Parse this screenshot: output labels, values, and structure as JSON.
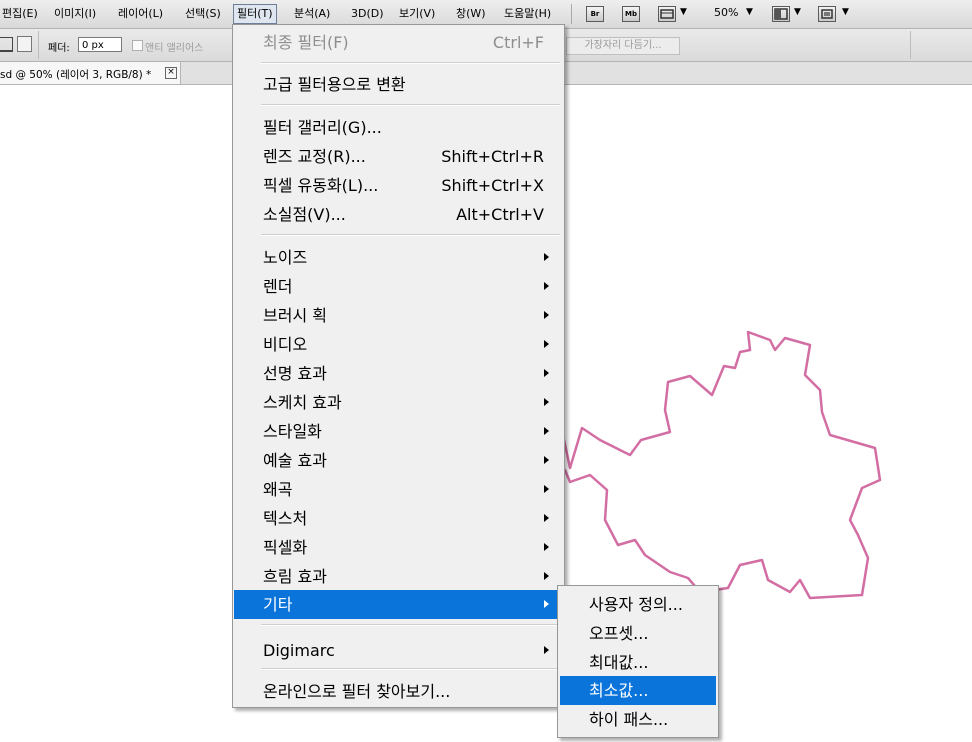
{
  "menubar": {
    "items": [
      {
        "label": "편집(E)"
      },
      {
        "label": "이미지(I)"
      },
      {
        "label": "레이어(L)"
      },
      {
        "label": "선택(S)"
      },
      {
        "label": "필터(T)"
      },
      {
        "label": "분석(A)"
      },
      {
        "label": "3D(D)"
      },
      {
        "label": "보기(V)"
      },
      {
        "label": "창(W)"
      },
      {
        "label": "도움말(H)"
      }
    ],
    "bridge_label": "Br",
    "minibridge_label": "Mb",
    "zoom_value": "50%"
  },
  "options": {
    "feather_label": "페더:",
    "feather_value": "0 px",
    "antialias_label": "앤티 앨리어스",
    "refine_edge_label": "가장자리 다듬기..."
  },
  "document": {
    "tab_title": "sd @ 50% (레이어 3, RGB/8) *",
    "close_glyph": "×"
  },
  "colors": {
    "outline": "#d36ea4",
    "highlight": "#0a74da"
  },
  "filter_menu": {
    "last_filter": {
      "label": "최종 필터(F)",
      "shortcut": "Ctrl+F"
    },
    "smart_convert": {
      "label": "고급 필터용으로 변환"
    },
    "filter_gallery": {
      "label": "필터 갤러리(G)..."
    },
    "lens_correction": {
      "label": "렌즈 교정(R)...",
      "shortcut": "Shift+Ctrl+R"
    },
    "liquify": {
      "label": "픽셀 유동화(L)...",
      "shortcut": "Shift+Ctrl+X"
    },
    "vanishing_point": {
      "label": "소실점(V)...",
      "shortcut": "Alt+Ctrl+V"
    },
    "groups": [
      {
        "label": "노이즈"
      },
      {
        "label": "렌더"
      },
      {
        "label": "브러시 획"
      },
      {
        "label": "비디오"
      },
      {
        "label": "선명 효과"
      },
      {
        "label": "스케치 효과"
      },
      {
        "label": "스타일화"
      },
      {
        "label": "예술 효과"
      },
      {
        "label": "왜곡"
      },
      {
        "label": "텍스처"
      },
      {
        "label": "픽셀화"
      },
      {
        "label": "흐림 효과"
      },
      {
        "label": "기타"
      }
    ],
    "digimarc": {
      "label": "Digimarc"
    },
    "browse_online": {
      "label": "온라인으로 필터 찾아보기..."
    }
  },
  "other_submenu": {
    "items": [
      {
        "label": "사용자 정의..."
      },
      {
        "label": "오프셋..."
      },
      {
        "label": "최대값..."
      },
      {
        "label": "최소값..."
      },
      {
        "label": "하이 패스..."
      }
    ]
  }
}
